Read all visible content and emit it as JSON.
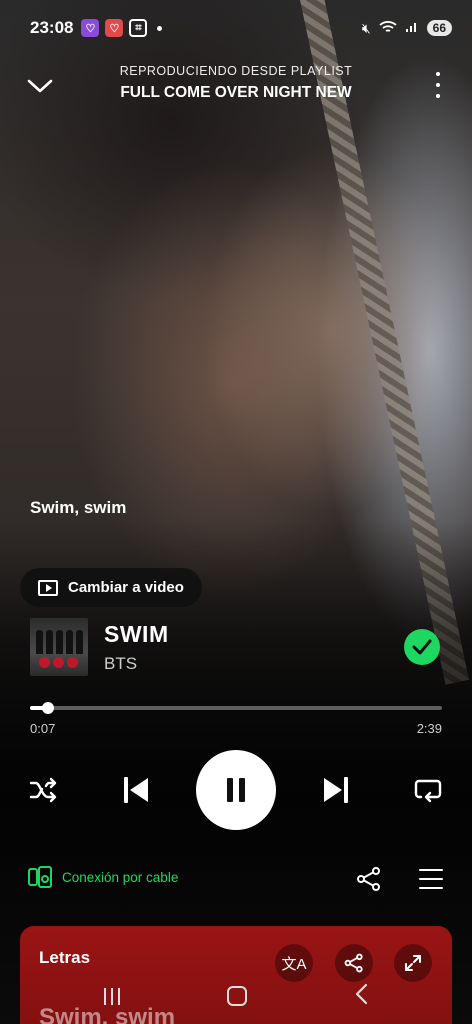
{
  "status_bar": {
    "time": "23:08",
    "battery": "66"
  },
  "header": {
    "subtitle": "REPRODUCIENDO DESDE PLAYLIST",
    "title": "FULL COME OVER NIGHT NEW"
  },
  "lyric_preview": "Swim, swim",
  "video_button": {
    "label": "Cambiar a video"
  },
  "track": {
    "title": "SWIM",
    "artist": "BTS",
    "saved": true
  },
  "progress": {
    "elapsed": "0:07",
    "total": "2:39",
    "fraction": 0.044
  },
  "device": {
    "label": "Conexión por cable"
  },
  "lyrics": {
    "label": "Letras",
    "line": "Swim, swim"
  },
  "colors": {
    "accent": "#1ed760",
    "lyrics_card": "#9a1414"
  }
}
